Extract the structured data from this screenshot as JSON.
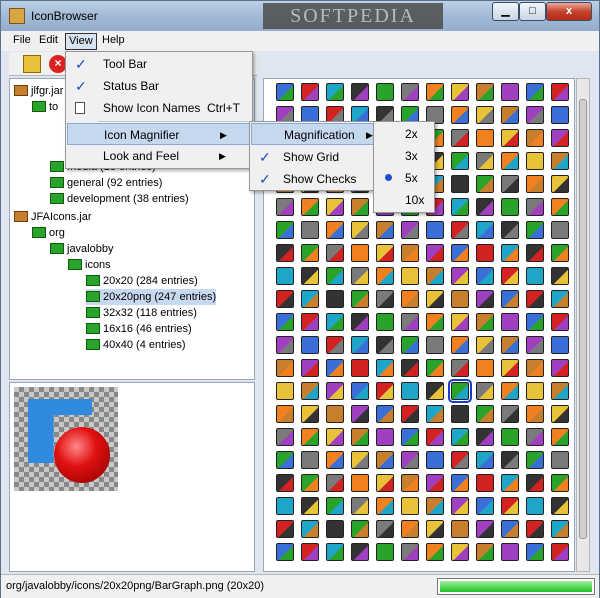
{
  "window": {
    "title": "IconBrowser",
    "watermark": "SOFTPEDIA",
    "close_glyph": "x"
  },
  "menubar": [
    "File",
    "Edit",
    "View",
    "Help"
  ],
  "view_menu": {
    "items": [
      {
        "label": "Tool Bar",
        "checked": true,
        "shortcut": "",
        "sub": false
      },
      {
        "label": "Status Bar",
        "checked": true,
        "shortcut": "",
        "sub": false
      },
      {
        "label": "Show Icon Names",
        "checked": false,
        "shortcut": "Ctrl+T",
        "sub": false
      },
      {
        "label": "Icon Magnifier",
        "checked": false,
        "shortcut": "",
        "sub": true
      },
      {
        "label": "Look and Feel",
        "checked": false,
        "shortcut": "",
        "sub": true
      }
    ]
  },
  "magnifier_menu": {
    "items": [
      {
        "label": "Magnification",
        "checked": false
      },
      {
        "label": "Show Grid",
        "checked": true
      },
      {
        "label": "Show Checks",
        "checked": true
      }
    ]
  },
  "magnification_menu": {
    "options": [
      "2x",
      "3x",
      "5x",
      "10x"
    ],
    "selected": "5x"
  },
  "tree": {
    "nodes": [
      {
        "label": "jlfgr.jar",
        "type": "jar",
        "depth": 0
      },
      {
        "label": "to",
        "type": "folder",
        "depth": 1
      },
      {
        "label": "media (18 entries)",
        "type": "folder",
        "depth": 2
      },
      {
        "label": "general (92 entries)",
        "type": "folder",
        "depth": 2
      },
      {
        "label": "development (38 entries)",
        "type": "folder",
        "depth": 2
      },
      {
        "label": "JFAIcons.jar",
        "type": "jar",
        "depth": 0
      },
      {
        "label": "org",
        "type": "folder",
        "depth": 1
      },
      {
        "label": "javalobby",
        "type": "folder",
        "depth": 2
      },
      {
        "label": "icons",
        "type": "folder",
        "depth": 3
      },
      {
        "label": "20x20 (284 entries)",
        "type": "folder",
        "depth": 4
      },
      {
        "label": "20x20png (247 entries)",
        "type": "folder",
        "depth": 4,
        "selected": true
      },
      {
        "label": "32x32 (118 entries)",
        "type": "folder",
        "depth": 4
      },
      {
        "label": "16x16 (46 entries)",
        "type": "folder",
        "depth": 4
      },
      {
        "label": "40x40 (4 entries)",
        "type": "folder",
        "depth": 4
      }
    ]
  },
  "status": {
    "path": "org/javalobby/icons/20x20png/BarGraph.png (20x20)",
    "progress": 1.0
  },
  "palette": [
    "#3a6fd8",
    "#e8c238",
    "#2aa32a",
    "#d22222",
    "#c77f2e",
    "#7a7a7a",
    "#1ea5c8",
    "#a040c0",
    "#f08020",
    "#333333"
  ]
}
